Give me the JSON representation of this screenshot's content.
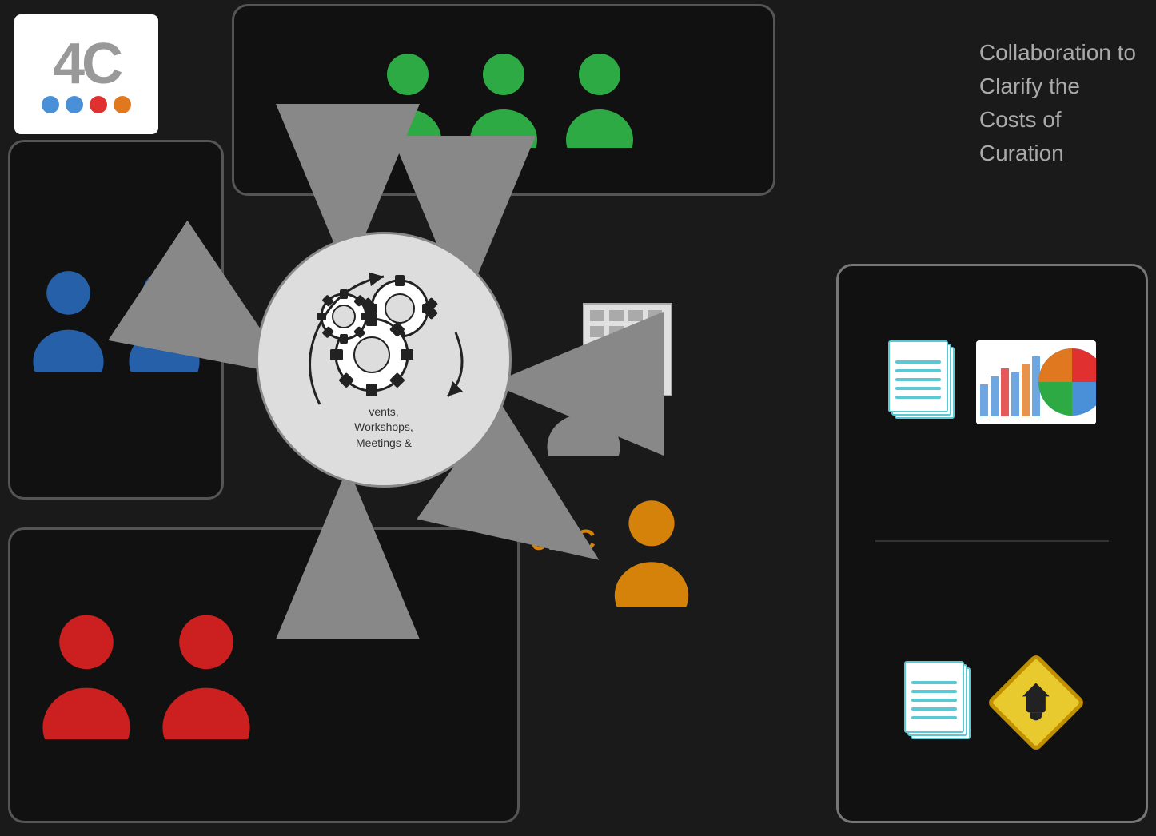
{
  "title": {
    "line1": "Collaboration to",
    "line2": "Clarify the",
    "line3": "Costs of",
    "line4": "Curation"
  },
  "logo": {
    "text": "4C",
    "dots": [
      "#4a90d9",
      "#4a90d9",
      "#e03030",
      "#e07820"
    ]
  },
  "center_circle": {
    "text": "vents,\nWorkshops,\nMeetings &"
  },
  "jisc": {
    "label": "JISC"
  },
  "people": {
    "green_count": 3,
    "blue_count": 2,
    "red_count": 2
  }
}
